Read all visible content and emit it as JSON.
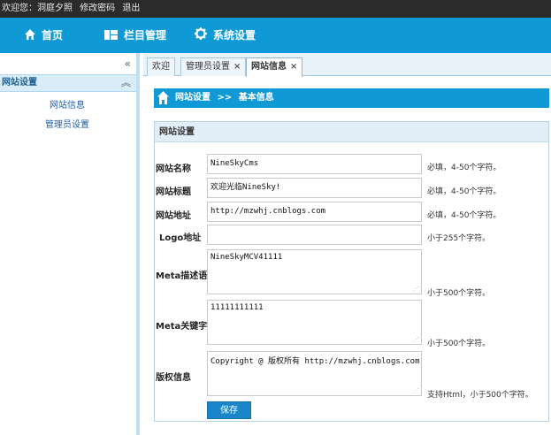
{
  "user_bar": {
    "greeting": "欢迎您：洞庭夕照",
    "change_password": "修改密码",
    "logout": "退出"
  },
  "main_nav": {
    "home": "首页",
    "column_manage": "栏目管理",
    "system_settings": "系统设置"
  },
  "sidebar": {
    "collapse_glyph": "«",
    "group_title": "网站设置",
    "group_toggle_glyph": "︽",
    "items": [
      {
        "label": "网站信息"
      },
      {
        "label": "管理员设置"
      }
    ]
  },
  "tabs": [
    {
      "label": "欢迎",
      "closable": false
    },
    {
      "label": "管理员设置",
      "closable": true
    },
    {
      "label": "网站信息",
      "closable": true,
      "active": true
    }
  ],
  "tab_close_glyph": "×",
  "breadcrumb": {
    "section": "网站设置",
    "separator": ">>",
    "page": "基本信息"
  },
  "panel": {
    "title": "网站设置"
  },
  "form": {
    "site_name": {
      "label": "网站名称",
      "value": "NineSkyCms",
      "hint": "必填，4-50个字符。"
    },
    "site_title": {
      "label": "网站标题",
      "value": "欢迎光临NineSky!",
      "hint": "必填，4-50个字符。"
    },
    "site_url": {
      "label": "网站地址",
      "value": "http://mzwhj.cnblogs.com",
      "hint": "必填，4-50个字符。"
    },
    "logo_url": {
      "label": "Logo地址",
      "value": "",
      "hint": "小于255个字符。"
    },
    "meta_description": {
      "label": "Meta描述语",
      "value": "NineSkyMCV41111",
      "hint": "小于500个字符。"
    },
    "meta_keywords": {
      "label": "Meta关键字",
      "value": "11111111111",
      "hint": "小于500个字符。"
    },
    "copyright": {
      "label": "版权信息",
      "value": "Copyright @ 版权所有 http://mzwhj.cnblogs.com",
      "hint": "支持Html，小于500个字符。"
    }
  },
  "save_button": "保存",
  "colors": {
    "nav_bar": "#0f99d5",
    "user_bar": "#2b2b2b",
    "sidebar_group_bg": "#d9edf9",
    "link_blue": "#1f5ea8",
    "save_button": "#1a86c9"
  },
  "icons": {
    "home": "home-icon",
    "columns": "grid-icon",
    "settings": "gear-icon"
  }
}
